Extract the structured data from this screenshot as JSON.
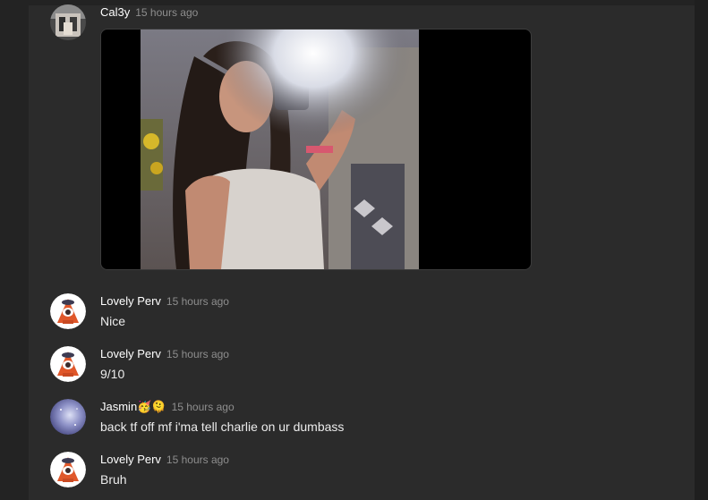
{
  "messages": [
    {
      "author": "Cal3y",
      "time": "15 hours ago",
      "text": "",
      "avatar_icon": "user-avatar-photo",
      "attachment": "image"
    },
    {
      "author": "Lovely Perv",
      "time": "15 hours ago",
      "text": "Nice",
      "avatar_icon": "triangle-mascot-avatar"
    },
    {
      "author": "Lovely Perv",
      "time": "15 hours ago",
      "text": "9/10",
      "avatar_icon": "triangle-mascot-avatar"
    },
    {
      "author": "Jasmin🥳🫠",
      "time": "15 hours ago",
      "text": "back tf off mf i'ma tell charlie on ur dumbass",
      "avatar_icon": "galaxy-avatar"
    },
    {
      "author": "Lovely Perv",
      "time": "15 hours ago",
      "text": "Bruh",
      "avatar_icon": "triangle-mascot-avatar"
    }
  ],
  "colors": {
    "background": "#2b2b2b",
    "author": "#ffffff",
    "timestamp": "#8e8e8e",
    "text": "#ececec"
  }
}
